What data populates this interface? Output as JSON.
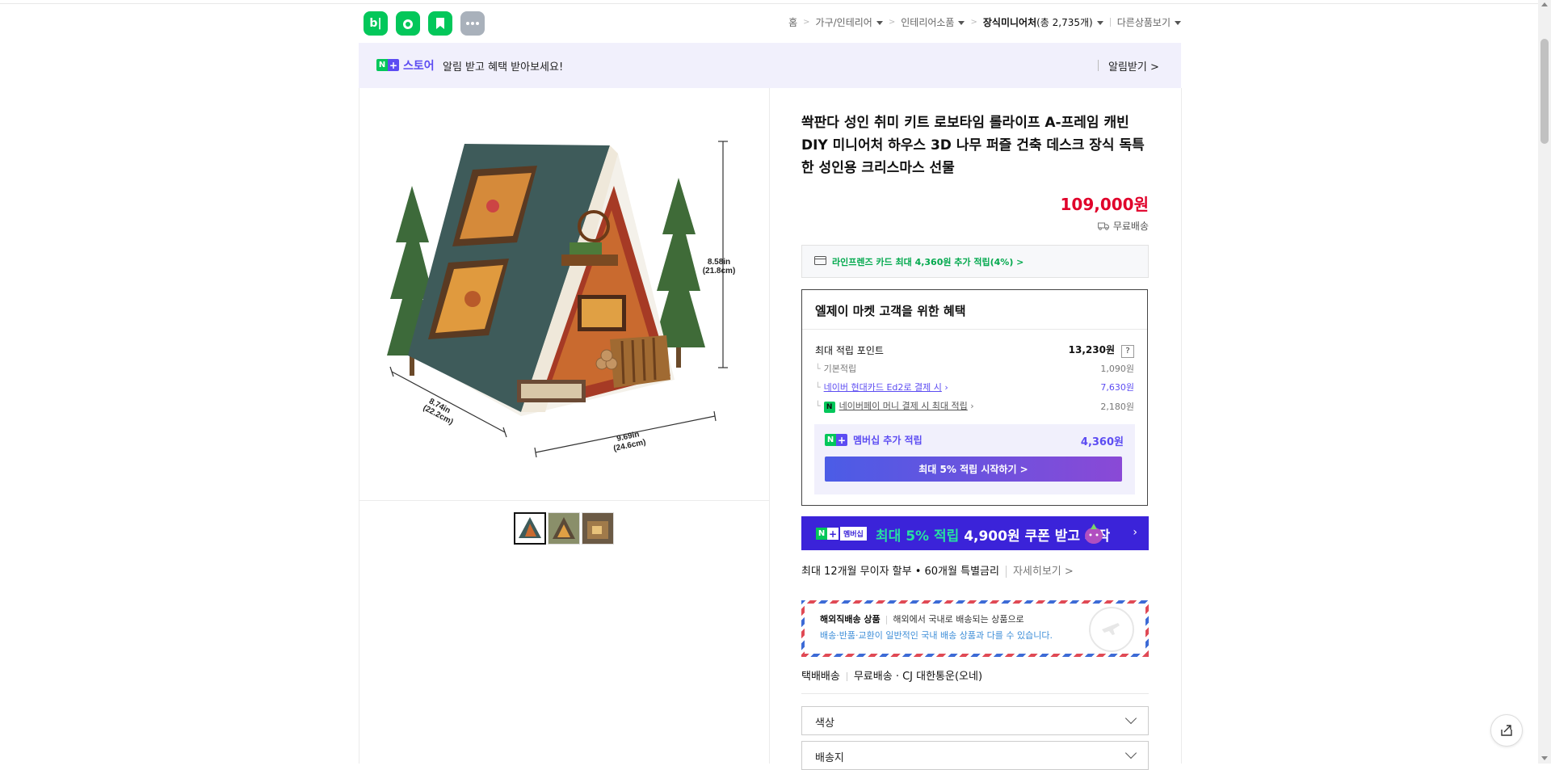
{
  "apps": [
    {
      "name": "blog",
      "glyph": "b|",
      "color": "#03c75a"
    },
    {
      "name": "cafe",
      "glyph": "●",
      "color": "#03c75a"
    },
    {
      "name": "bookmark",
      "glyph": "▲",
      "color": "#03c75a"
    },
    {
      "name": "more",
      "glyph": "•••",
      "color": "#a9b1bb"
    }
  ],
  "breadcrumb": {
    "home": "홈",
    "cat1": "가구/인테리어",
    "cat2": "인테리어소품",
    "cat3": "장식미니어처",
    "cat3_count": "(총 2,735개)",
    "other": "다른상품보기"
  },
  "banner": {
    "store": "스토어",
    "text": "알림 받고 혜택 받아보세요!",
    "alarm": "알림받기 >"
  },
  "product": {
    "title": "쏵판다 성인 취미 키트 로보타임 롤라이프 A-프레임 캐빈 DIY 미니어처 하우스 3D 나무 퍼즐 건축 데스크 장식 독특한 성인용 크리스마스 선물",
    "price": "109,000원",
    "shipping": "무료배송",
    "dims": {
      "height": "8.58in",
      "height_cm": "(21.8cm)",
      "depth": "8.74in",
      "depth_cm": "(22.2cm)",
      "width": "9.69in",
      "width_cm": "(24.6cm)"
    }
  },
  "card_promo": "라인프렌즈 카드 최대 4,360원 추가 적립(4%) >",
  "benefits": {
    "title": "엘제이 마켓 고객을 위한 혜택",
    "max_label": "최대 적립 포인트",
    "max_value": "13,230원",
    "help": "?",
    "basic_label": "기본적립",
    "basic_value": "1,090원",
    "hyundai_label": "네이버 현대카드 Ed2로 결제 시",
    "hyundai_value": "7,630원",
    "npay_label": "네이버페이 머니 결제 시 최대 적립",
    "npay_value": "2,180원",
    "member_label": "멤버십 추가 적립",
    "member_value": "4,360원",
    "member_button": "최대 5% 적립 시작하기 >"
  },
  "promo_banner": {
    "badge": "멤버십",
    "highlight": "최대 5% 적립",
    "rest": "4,900원 쿠폰 받고 시작"
  },
  "installment": {
    "text": "최대 12개월 무이자 할부 • 60개월 특별금리",
    "more": "자세히보기 >"
  },
  "overseas": {
    "title": "해외직배송 상품",
    "desc": "해외에서 국내로 배송되는 상품으로",
    "note": "배송·반품·교환이 일반적인 국내 배송 상품과 다를 수 있습니다."
  },
  "delivery": {
    "type": "택배배송",
    "fee": "무료배송",
    "courier": "· CJ 대한통운(오네)"
  },
  "options": {
    "color": "색상",
    "destination": "배송지"
  },
  "icons": {
    "share": "share-icon"
  }
}
